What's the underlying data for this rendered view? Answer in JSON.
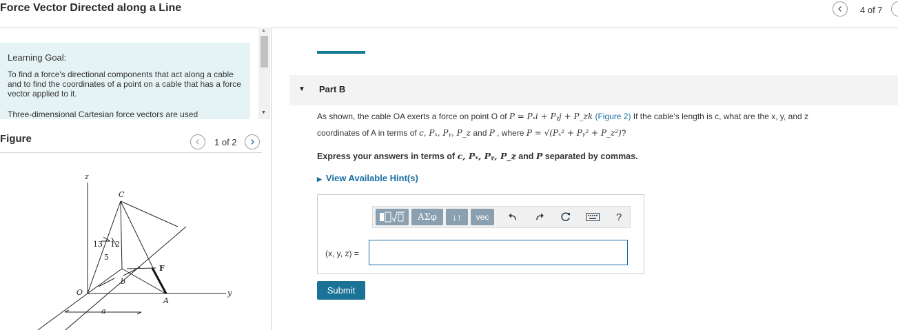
{
  "header": {
    "title": "Force Vector Directed along a Line",
    "page_counter": "4 of 7"
  },
  "learning_goal": {
    "heading": "Learning Goal:",
    "text": "To find a force's directional components that act along a cable and to find the coordinates of a point on a cable that has a force vector applied to it.",
    "text2": "Three-dimensional Cartesian force vectors are used"
  },
  "figure": {
    "heading": "Figure",
    "counter": "1 of 2",
    "labels": {
      "z": "z",
      "C": "C",
      "n13": "13",
      "n12": "12",
      "n5": "5",
      "F": "F",
      "b": "b",
      "O": "O",
      "A": "A",
      "y": "y",
      "a": "a"
    }
  },
  "part": {
    "label": "Part B"
  },
  "question": {
    "line1_pre": "As shown, the cable OA exerts a force on point O of ",
    "line1_math": "P = Pₓi + Pᵧj + P_zk",
    "line1_link": "(Figure 2)",
    "line1_post": " If the cable's length is c, what are the x, y, and z",
    "line2_pre": "coordinates of A in terms of ",
    "line2_math1": "c, Pₓ, Pᵧ, P_z",
    "line2_mid": " and ",
    "line2_math2": "P",
    "line2_mid2": " , where ",
    "line2_math3": "P = √(Pₓ² + Pᵧ² + P_z²)",
    "line2_post": "?",
    "instruction_pre": "Express your answers in terms of ",
    "instruction_math": "c, Pₓ, Pᵧ, P_z",
    "instruction_mid": " and ",
    "instruction_math2": "P",
    "instruction_post": " separated by commas."
  },
  "hint": {
    "label": "View Available Hint(s)"
  },
  "answer": {
    "toolbar": {
      "greek": "ΑΣφ",
      "arrows": "↓↑",
      "vec": "vec",
      "help": "?"
    },
    "label": "(x, y, z) =",
    "value": ""
  },
  "submit": {
    "label": "Submit"
  }
}
